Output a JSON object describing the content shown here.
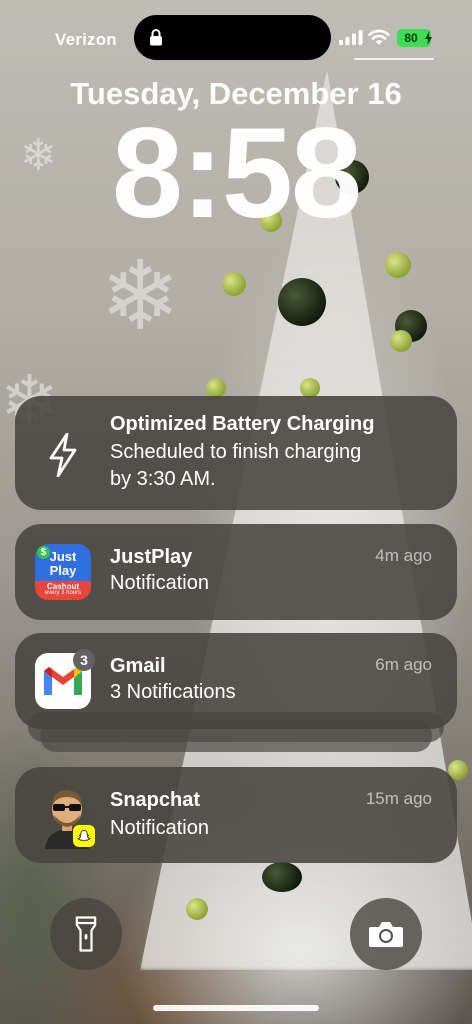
{
  "status_bar": {
    "carrier": "Verizon",
    "battery_level": "80",
    "battery_charging": true,
    "signal_bars": 4,
    "lock_icon": "lock-icon"
  },
  "lock_screen": {
    "date": "Tuesday, December 16",
    "time": "8:58"
  },
  "notifications": [
    {
      "app": "Optimized Battery Charging",
      "icon": "lightning-bolt-icon",
      "body_line1": "Scheduled to finish charging",
      "body_line2": "by 3:30 AM.",
      "time": ""
    },
    {
      "app": "JustPlay",
      "icon": "justplay-app-icon",
      "icon_text_main": "Just Play",
      "icon_text_sub": "Cashout",
      "icon_text_sub2": "every 3 hours",
      "body": "Notification",
      "time": "4m ago"
    },
    {
      "app": "Gmail",
      "icon": "gmail-app-icon",
      "badge_count": "3",
      "body": "3 Notifications",
      "time": "6m ago"
    },
    {
      "app": "Snapchat",
      "icon": "snapchat-bitmoji-icon",
      "body": "Notification",
      "time": "15m ago"
    }
  ],
  "controls": {
    "flashlight_icon": "flashlight-icon",
    "camera_icon": "camera-icon"
  },
  "colors": {
    "battery_green": "#3ddc55",
    "notification_bg": "#48443f",
    "justplay_blue": "#2f6fe0",
    "justplay_red": "#e8453c",
    "snapchat_yellow": "#fffc00",
    "gmail_red": "#ea4335"
  }
}
